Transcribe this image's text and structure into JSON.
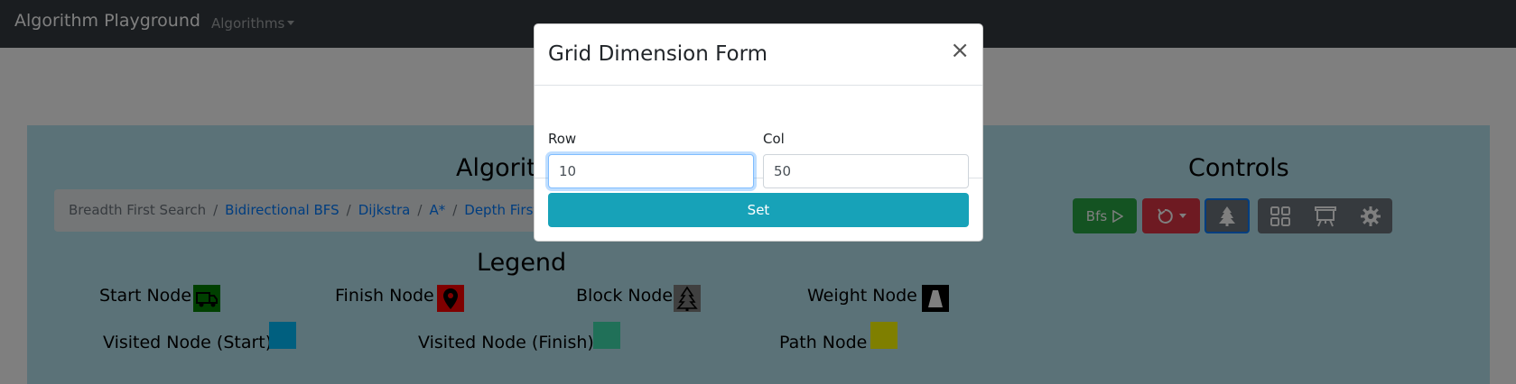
{
  "navbar": {
    "brand": "Algorithm Playground",
    "dropdown_label": "Algorithms"
  },
  "main": {
    "algo_title": "Algorithms",
    "legend_title": "Legend",
    "controls_title": "Controls",
    "breadcrumb": {
      "active": "Breadth First Search",
      "links": [
        "Bidirectional BFS",
        "Dijkstra",
        "A*",
        "Depth First Search"
      ],
      "separator": "/"
    },
    "legend": [
      {
        "label": "Start Node",
        "color": "#008000",
        "icon": "truck-icon"
      },
      {
        "label": "Finish Node",
        "color": "#ff0000",
        "icon": "map-pin-icon"
      },
      {
        "label": "Block Node",
        "color": "#808080",
        "icon": "tree-icon"
      },
      {
        "label": "Weight Node",
        "color": "#000000",
        "icon": "weight-icon"
      },
      {
        "label": "Visited Node (Start)",
        "color": "#00bfff"
      },
      {
        "label": "Visited Node (Finish)",
        "color": "#40e0b0"
      },
      {
        "label": "Path Node",
        "color": "#ffff00"
      }
    ],
    "controls": {
      "run_label": "Bfs",
      "run_icon": "play-icon",
      "reset_icon": "reset-icon",
      "block_icon": "tree-icon",
      "grid_icon": "grid-icon",
      "board_icon": "easel-icon",
      "settings_icon": "gear-icon"
    }
  },
  "modal": {
    "title": "Grid Dimension Form",
    "close_label": "×",
    "row_label": "Row",
    "row_value": "10",
    "col_label": "Col",
    "col_value": "50",
    "submit_label": "Set"
  },
  "colors": {
    "navbar_bg": "#343a40",
    "panel_bg": "#b7e4f0",
    "set_button": "#17a2b8",
    "run_button": "#28a745",
    "reset_button": "#dc3545"
  }
}
